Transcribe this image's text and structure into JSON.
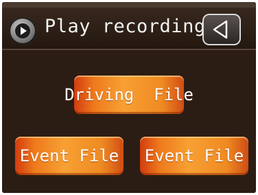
{
  "header": {
    "title": "Play recording",
    "play_icon": "play-circle-icon",
    "back_icon": "back-triangle-icon"
  },
  "buttons": {
    "driving_file": "Driving  File",
    "event_file_1": "Event File",
    "event_file_2": "Event File"
  },
  "colors": {
    "background": "#2b1d14",
    "button_accent": "#f7a033",
    "title_text": "#f2f2f2"
  }
}
